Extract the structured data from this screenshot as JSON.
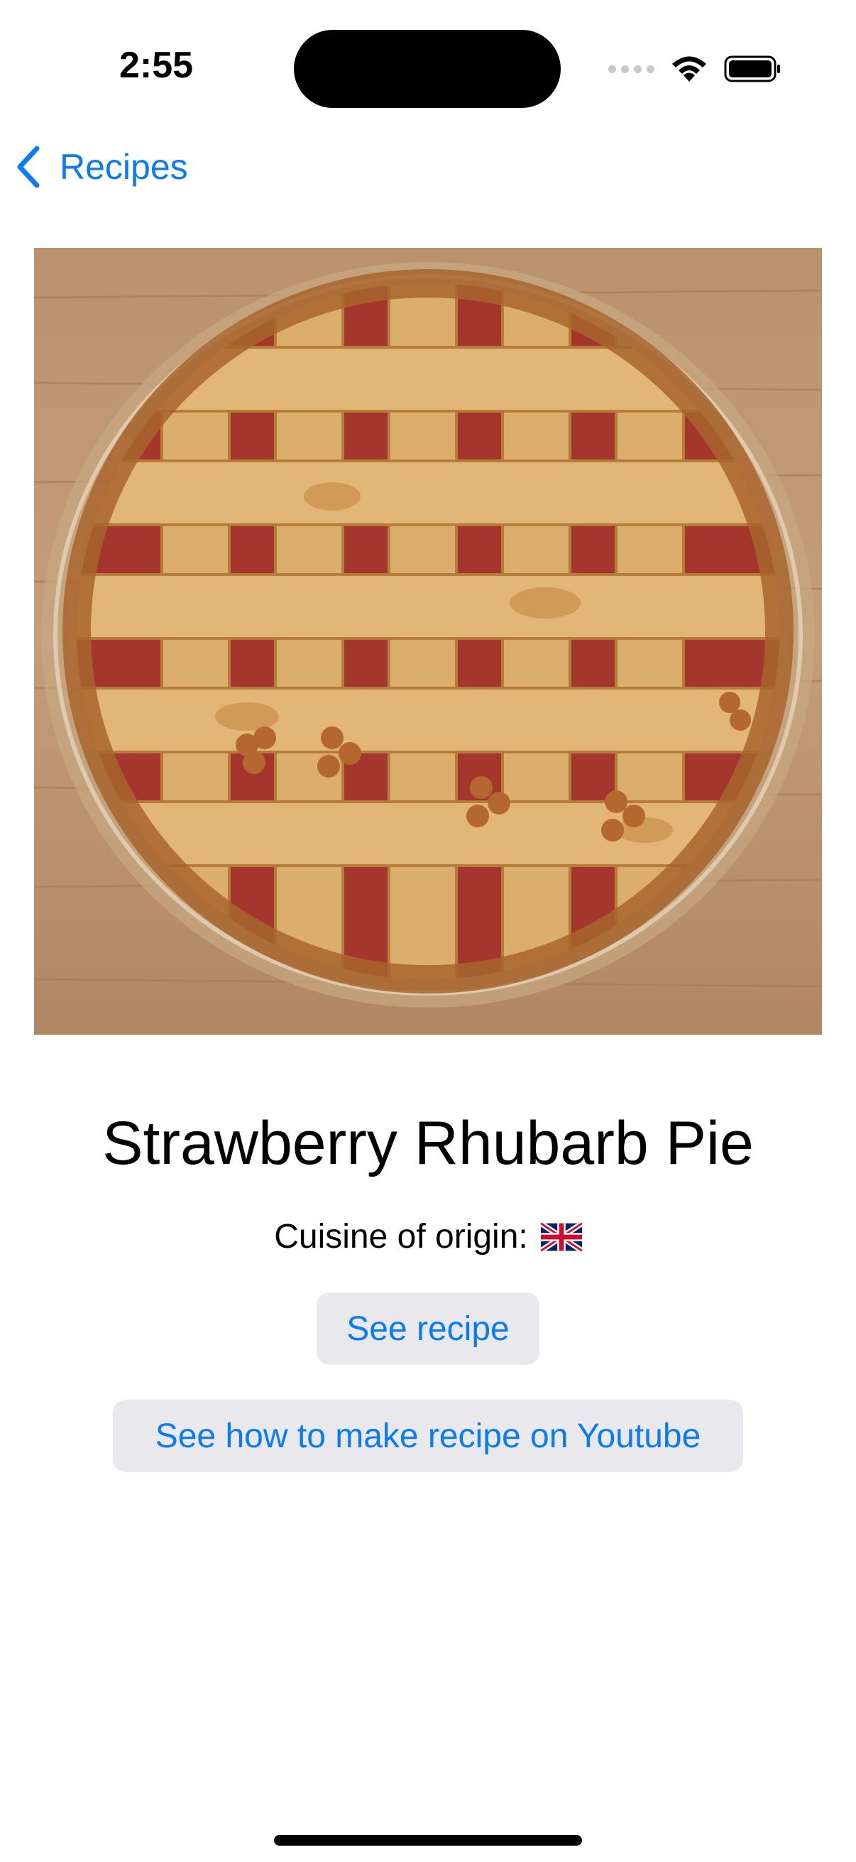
{
  "status_bar": {
    "time": "2:55"
  },
  "nav": {
    "back_label": "Recipes",
    "accent_color": "#0a7bf2"
  },
  "recipe": {
    "title": "Strawberry Rhubarb Pie",
    "cuisine_label": "Cuisine of origin:",
    "cuisine_flag": "uk-flag-icon"
  },
  "buttons": {
    "see_recipe": "See recipe",
    "see_youtube": "See how to make recipe on Youtube"
  },
  "icons": {
    "back": "chevron-left-icon",
    "wifi": "wifi-icon",
    "battery": "battery-icon",
    "signal": "cellular-signal-icon"
  }
}
